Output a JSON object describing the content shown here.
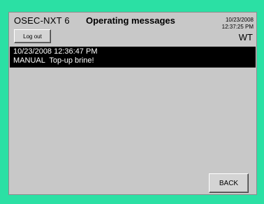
{
  "header": {
    "device_name": "OSEC-NXT 6",
    "title": "Operating messages",
    "date": "10/23/2008",
    "time": "12:37:25 PM",
    "user": "WT",
    "logout_label": "Log out"
  },
  "messages": [
    {
      "timestamp": "10/23/2008 12:36:47 PM",
      "text": "MANUAL  Top-up brine!"
    }
  ],
  "footer": {
    "back_label": "BACK"
  }
}
